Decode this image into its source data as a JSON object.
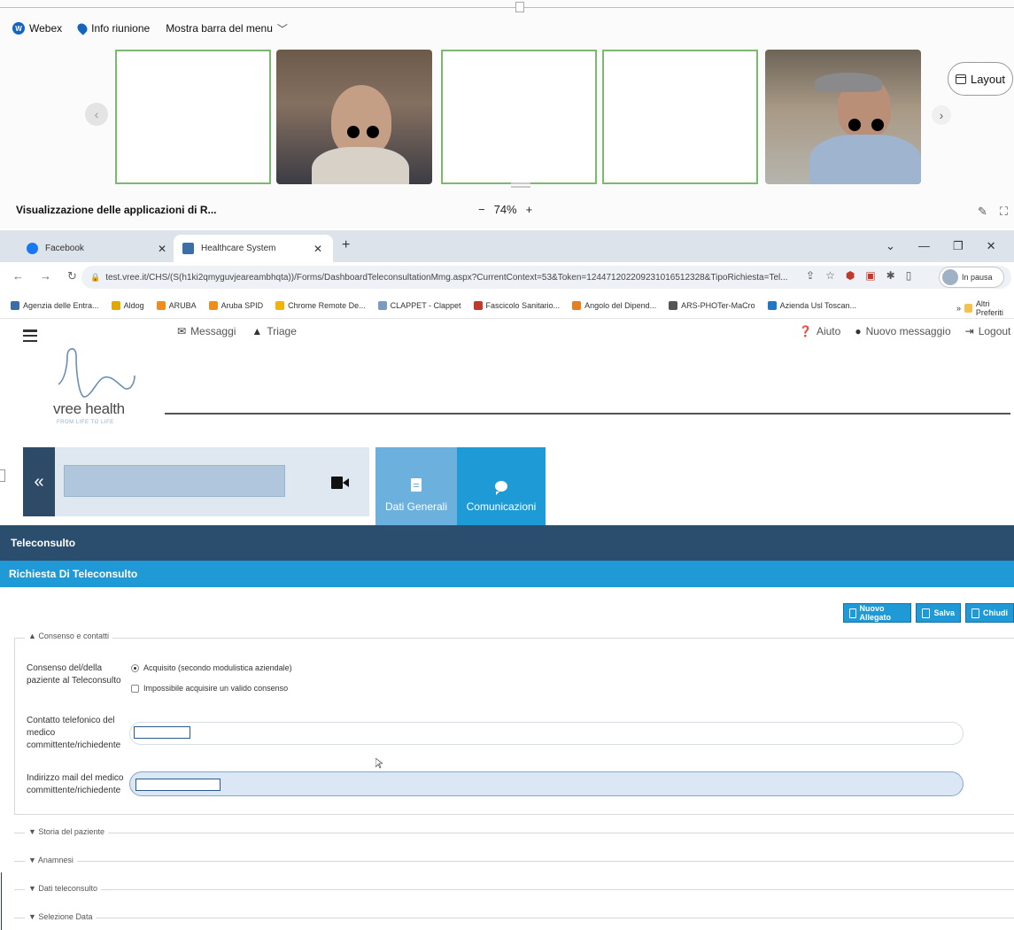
{
  "webex": {
    "menu": {
      "app": "Webex",
      "meeting_info": "Info riunione",
      "show_menu": "Mostra barra del menu"
    },
    "layout_label": "Layout",
    "share_title": "Visualizzazione delle applicazioni di R...",
    "zoom_minus": "−",
    "zoom_value": "74%",
    "zoom_plus": "+"
  },
  "browser": {
    "tabs": [
      {
        "label": "Facebook",
        "active": false
      },
      {
        "label": "Healthcare System",
        "active": true
      }
    ],
    "url": "test.vree.it/CHS/(S(h1ki2qmyguvjeareambhqta))/Forms/DashboardTeleconsultationMmg.aspx?CurrentContext=53&Token=124471202209231016512328&TipoRichiesta=Tel...",
    "pause_label": "In pausa",
    "bookmarks": [
      {
        "label": "Agenzia delle Entra...",
        "color": "#3a6ea5"
      },
      {
        "label": "Aldog",
        "color": "#e0a800"
      },
      {
        "label": "ARUBA",
        "color": "#f08c1a"
      },
      {
        "label": "Aruba SPID",
        "color": "#f08c1a"
      },
      {
        "label": "Chrome Remote De...",
        "color": "#f2b400"
      },
      {
        "label": "CLAPPET - Clappet",
        "color": "#7a9ac0"
      },
      {
        "label": "Fascicolo Sanitario...",
        "color": "#c0392b"
      },
      {
        "label": "Angolo del Dipend...",
        "color": "#e67e22"
      },
      {
        "label": "ARS-PHOTer-MaCro",
        "color": "#555555"
      },
      {
        "label": "Azienda Usl Toscan...",
        "color": "#1f78c8"
      }
    ],
    "bookmarks_more": "»",
    "other_bookmarks": "Altri Preferiti"
  },
  "app": {
    "logo_text": "vree health",
    "logo_tagline": "FROM LIFE TO LIFE",
    "nav": {
      "messages": "Messaggi",
      "triage": "Triage"
    },
    "right": {
      "help": "Aiuto",
      "new_message": "Nuovo messaggio",
      "logout": "Logout"
    },
    "collapse_label": "«",
    "tabs": {
      "general": "Dati Generali",
      "communications": "Comunicazioni"
    },
    "section_title": "Teleconsulto",
    "subsection_title": "Richiesta Di Teleconsulto",
    "actions": {
      "new_attachment": "Nuovo Allegato",
      "save": "Salva",
      "close": "Chiudi"
    },
    "consent_fieldset": {
      "legend": "▲ Consenso e contatti",
      "consent_label": "Consenso del/della paziente al Teleconsulto",
      "option_acquired": "Acquisito (secondo modulistica aziendale)",
      "option_impossible": "Impossibile acquisire un valido consenso",
      "phone_label": "Contatto telefonico del medico committente/richiedente",
      "mail_label": "Indirizzo mail del medico committente/richiedente"
    },
    "collapsed_sections": [
      "▼ Storia del paziente",
      "▼ Anamnesi",
      "▼ Dati teleconsulto",
      "▼ Selezione Data"
    ]
  },
  "colors": {
    "primary_dark": "#2b4e6e",
    "primary": "#1f9ad6",
    "tab_light": "#6cb0dd",
    "tile_border": "#7cb86f"
  }
}
